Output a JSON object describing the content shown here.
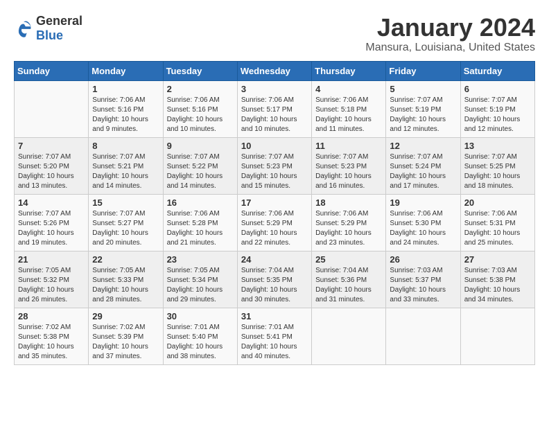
{
  "logo": {
    "general": "General",
    "blue": "Blue"
  },
  "title": "January 2024",
  "subtitle": "Mansura, Louisiana, United States",
  "headers": [
    "Sunday",
    "Monday",
    "Tuesday",
    "Wednesday",
    "Thursday",
    "Friday",
    "Saturday"
  ],
  "weeks": [
    [
      {
        "day": "",
        "sunrise": "",
        "sunset": "",
        "daylight": ""
      },
      {
        "day": "1",
        "sunrise": "Sunrise: 7:06 AM",
        "sunset": "Sunset: 5:16 PM",
        "daylight": "Daylight: 10 hours and 9 minutes."
      },
      {
        "day": "2",
        "sunrise": "Sunrise: 7:06 AM",
        "sunset": "Sunset: 5:16 PM",
        "daylight": "Daylight: 10 hours and 10 minutes."
      },
      {
        "day": "3",
        "sunrise": "Sunrise: 7:06 AM",
        "sunset": "Sunset: 5:17 PM",
        "daylight": "Daylight: 10 hours and 10 minutes."
      },
      {
        "day": "4",
        "sunrise": "Sunrise: 7:06 AM",
        "sunset": "Sunset: 5:18 PM",
        "daylight": "Daylight: 10 hours and 11 minutes."
      },
      {
        "day": "5",
        "sunrise": "Sunrise: 7:07 AM",
        "sunset": "Sunset: 5:19 PM",
        "daylight": "Daylight: 10 hours and 12 minutes."
      },
      {
        "day": "6",
        "sunrise": "Sunrise: 7:07 AM",
        "sunset": "Sunset: 5:19 PM",
        "daylight": "Daylight: 10 hours and 12 minutes."
      }
    ],
    [
      {
        "day": "7",
        "sunrise": "Sunrise: 7:07 AM",
        "sunset": "Sunset: 5:20 PM",
        "daylight": "Daylight: 10 hours and 13 minutes."
      },
      {
        "day": "8",
        "sunrise": "Sunrise: 7:07 AM",
        "sunset": "Sunset: 5:21 PM",
        "daylight": "Daylight: 10 hours and 14 minutes."
      },
      {
        "day": "9",
        "sunrise": "Sunrise: 7:07 AM",
        "sunset": "Sunset: 5:22 PM",
        "daylight": "Daylight: 10 hours and 14 minutes."
      },
      {
        "day": "10",
        "sunrise": "Sunrise: 7:07 AM",
        "sunset": "Sunset: 5:23 PM",
        "daylight": "Daylight: 10 hours and 15 minutes."
      },
      {
        "day": "11",
        "sunrise": "Sunrise: 7:07 AM",
        "sunset": "Sunset: 5:23 PM",
        "daylight": "Daylight: 10 hours and 16 minutes."
      },
      {
        "day": "12",
        "sunrise": "Sunrise: 7:07 AM",
        "sunset": "Sunset: 5:24 PM",
        "daylight": "Daylight: 10 hours and 17 minutes."
      },
      {
        "day": "13",
        "sunrise": "Sunrise: 7:07 AM",
        "sunset": "Sunset: 5:25 PM",
        "daylight": "Daylight: 10 hours and 18 minutes."
      }
    ],
    [
      {
        "day": "14",
        "sunrise": "Sunrise: 7:07 AM",
        "sunset": "Sunset: 5:26 PM",
        "daylight": "Daylight: 10 hours and 19 minutes."
      },
      {
        "day": "15",
        "sunrise": "Sunrise: 7:07 AM",
        "sunset": "Sunset: 5:27 PM",
        "daylight": "Daylight: 10 hours and 20 minutes."
      },
      {
        "day": "16",
        "sunrise": "Sunrise: 7:06 AM",
        "sunset": "Sunset: 5:28 PM",
        "daylight": "Daylight: 10 hours and 21 minutes."
      },
      {
        "day": "17",
        "sunrise": "Sunrise: 7:06 AM",
        "sunset": "Sunset: 5:29 PM",
        "daylight": "Daylight: 10 hours and 22 minutes."
      },
      {
        "day": "18",
        "sunrise": "Sunrise: 7:06 AM",
        "sunset": "Sunset: 5:29 PM",
        "daylight": "Daylight: 10 hours and 23 minutes."
      },
      {
        "day": "19",
        "sunrise": "Sunrise: 7:06 AM",
        "sunset": "Sunset: 5:30 PM",
        "daylight": "Daylight: 10 hours and 24 minutes."
      },
      {
        "day": "20",
        "sunrise": "Sunrise: 7:06 AM",
        "sunset": "Sunset: 5:31 PM",
        "daylight": "Daylight: 10 hours and 25 minutes."
      }
    ],
    [
      {
        "day": "21",
        "sunrise": "Sunrise: 7:05 AM",
        "sunset": "Sunset: 5:32 PM",
        "daylight": "Daylight: 10 hours and 26 minutes."
      },
      {
        "day": "22",
        "sunrise": "Sunrise: 7:05 AM",
        "sunset": "Sunset: 5:33 PM",
        "daylight": "Daylight: 10 hours and 28 minutes."
      },
      {
        "day": "23",
        "sunrise": "Sunrise: 7:05 AM",
        "sunset": "Sunset: 5:34 PM",
        "daylight": "Daylight: 10 hours and 29 minutes."
      },
      {
        "day": "24",
        "sunrise": "Sunrise: 7:04 AM",
        "sunset": "Sunset: 5:35 PM",
        "daylight": "Daylight: 10 hours and 30 minutes."
      },
      {
        "day": "25",
        "sunrise": "Sunrise: 7:04 AM",
        "sunset": "Sunset: 5:36 PM",
        "daylight": "Daylight: 10 hours and 31 minutes."
      },
      {
        "day": "26",
        "sunrise": "Sunrise: 7:03 AM",
        "sunset": "Sunset: 5:37 PM",
        "daylight": "Daylight: 10 hours and 33 minutes."
      },
      {
        "day": "27",
        "sunrise": "Sunrise: 7:03 AM",
        "sunset": "Sunset: 5:38 PM",
        "daylight": "Daylight: 10 hours and 34 minutes."
      }
    ],
    [
      {
        "day": "28",
        "sunrise": "Sunrise: 7:02 AM",
        "sunset": "Sunset: 5:38 PM",
        "daylight": "Daylight: 10 hours and 35 minutes."
      },
      {
        "day": "29",
        "sunrise": "Sunrise: 7:02 AM",
        "sunset": "Sunset: 5:39 PM",
        "daylight": "Daylight: 10 hours and 37 minutes."
      },
      {
        "day": "30",
        "sunrise": "Sunrise: 7:01 AM",
        "sunset": "Sunset: 5:40 PM",
        "daylight": "Daylight: 10 hours and 38 minutes."
      },
      {
        "day": "31",
        "sunrise": "Sunrise: 7:01 AM",
        "sunset": "Sunset: 5:41 PM",
        "daylight": "Daylight: 10 hours and 40 minutes."
      },
      {
        "day": "",
        "sunrise": "",
        "sunset": "",
        "daylight": ""
      },
      {
        "day": "",
        "sunrise": "",
        "sunset": "",
        "daylight": ""
      },
      {
        "day": "",
        "sunrise": "",
        "sunset": "",
        "daylight": ""
      }
    ]
  ]
}
